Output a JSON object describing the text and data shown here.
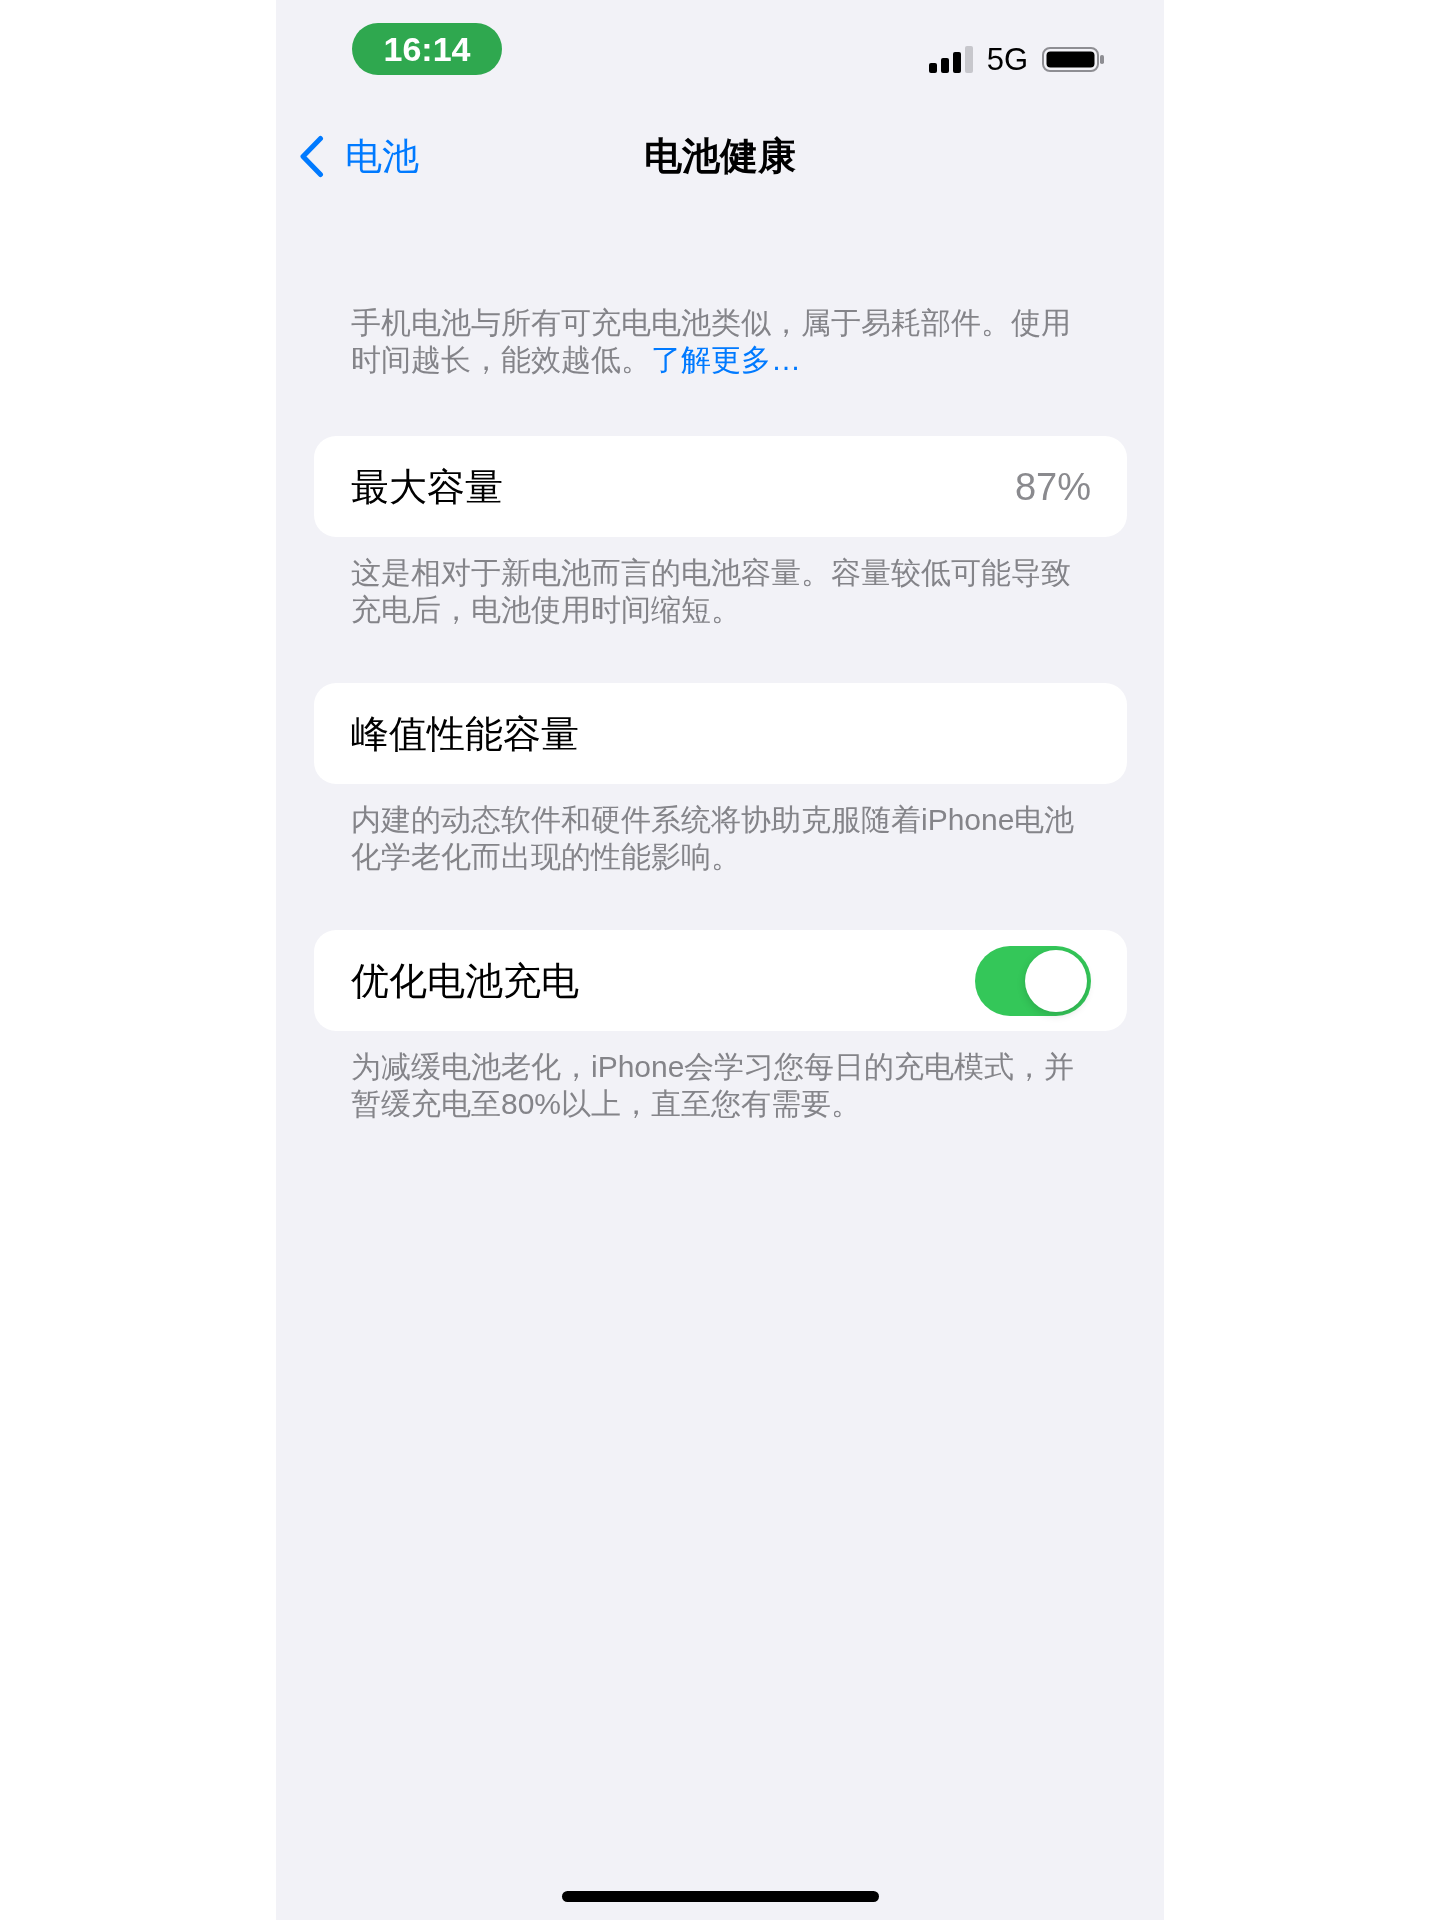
{
  "status_bar": {
    "time": "16:14",
    "network": "5G"
  },
  "nav_bar": {
    "back_label": "电池",
    "title": "电池健康"
  },
  "intro": {
    "text": "手机电池与所有可充电电池类似，属于易耗部件。使用时间越长，能效越低。",
    "link": "了解更多…"
  },
  "sections": [
    {
      "kind": "value",
      "label": "最大容量",
      "value": "87%",
      "footer": "这是相对于新电池而言的电池容量。容量较低可能导致充电后，电池使用时间缩短。"
    },
    {
      "kind": "plain",
      "label": "峰值性能容量",
      "footer": "内建的动态软件和硬件系统将协助克服随着iPhone电池化学老化而出现的性能影响。"
    },
    {
      "kind": "toggle",
      "label": "优化电池充电",
      "on": true,
      "footer": "为减缓电池老化，iPhone会学习您每日的充电模式，并暂缓充电至80%以上，直至您有需要。"
    }
  ]
}
